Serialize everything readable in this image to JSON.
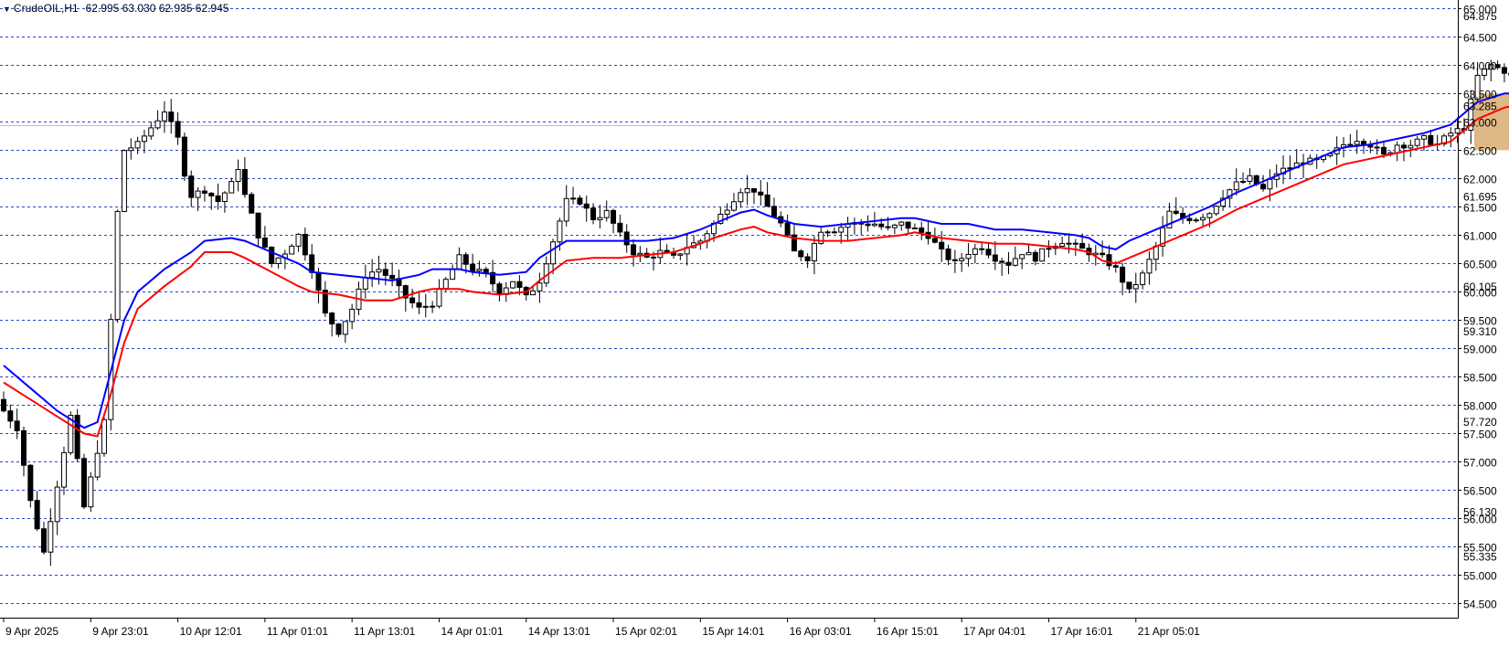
{
  "window": {
    "symbol_label": "CrudeOIL,H1",
    "ohlc_label": "62.995 63.030 62.935 62.945"
  },
  "colors": {
    "background": "#ffffff",
    "grid": "#2a45c9",
    "axis": "#000000",
    "price_highlight": "#2a45c9",
    "ma_fast": "#0000ff",
    "ma_slow": "#ff0000",
    "zone": "#deb887",
    "bull_candle": "#ffffff",
    "bear_candle": "#000000"
  },
  "chart_data": {
    "type": "candlestick",
    "ylim": [
      54.25,
      65.15
    ],
    "grid": true,
    "price_levels": [
      "65.000",
      "64.500",
      "64.000",
      "63.500",
      "63.000",
      "62.500",
      "62.000",
      "61.500",
      "61.000",
      "60.500",
      "60.000",
      "59.500",
      "59.000",
      "58.500",
      "58.000",
      "57.500",
      "57.000",
      "56.500",
      "56.000",
      "55.500",
      "55.000",
      "54.500"
    ],
    "minor_labels": [
      "64.875",
      "63.285",
      "61.695",
      "60.105",
      "59.310",
      "57.720",
      "56.130",
      "55.335"
    ],
    "x_labels": [
      "9 Apr 2025",
      "9 Apr 23:01",
      "10 Apr 12:01",
      "11 Apr 01:01",
      "11 Apr 13:01",
      "14 Apr 01:01",
      "14 Apr 13:01",
      "15 Apr 02:01",
      "15 Apr 14:01",
      "16 Apr 03:01",
      "16 Apr 15:01",
      "17 Apr 04:01",
      "17 Apr 16:01",
      "21 Apr 05:01"
    ],
    "bars_per_label": 13,
    "close_path": [
      [
        0,
        57.9
      ],
      [
        2,
        57.6
      ],
      [
        4,
        56.3
      ],
      [
        6,
        55.4
      ],
      [
        8,
        56.6
      ],
      [
        10,
        57.8
      ],
      [
        12,
        56.2
      ],
      [
        14,
        57.2
      ],
      [
        15,
        57.7
      ],
      [
        16,
        59.5
      ],
      [
        17,
        61.4
      ],
      [
        18,
        62.5
      ],
      [
        20,
        62.6
      ],
      [
        22,
        62.9
      ],
      [
        24,
        63.2
      ],
      [
        26,
        62.7
      ],
      [
        27,
        62.1
      ],
      [
        28,
        61.7
      ],
      [
        30,
        61.8
      ],
      [
        32,
        61.6
      ],
      [
        34,
        61.9
      ],
      [
        35,
        62.2
      ],
      [
        36,
        61.7
      ],
      [
        38,
        61.0
      ],
      [
        40,
        60.5
      ],
      [
        42,
        60.7
      ],
      [
        44,
        61.0
      ],
      [
        46,
        60.4
      ],
      [
        48,
        59.6
      ],
      [
        50,
        59.3
      ],
      [
        52,
        59.7
      ],
      [
        54,
        60.3
      ],
      [
        56,
        60.4
      ],
      [
        58,
        60.2
      ],
      [
        60,
        59.9
      ],
      [
        62,
        59.7
      ],
      [
        64,
        59.8
      ],
      [
        66,
        60.2
      ],
      [
        68,
        60.6
      ],
      [
        70,
        60.4
      ],
      [
        72,
        60.3
      ],
      [
        74,
        60.0
      ],
      [
        76,
        60.2
      ],
      [
        78,
        59.9
      ],
      [
        80,
        60.2
      ],
      [
        82,
        60.9
      ],
      [
        84,
        61.6
      ],
      [
        86,
        61.6
      ],
      [
        88,
        61.3
      ],
      [
        90,
        61.4
      ],
      [
        92,
        61.0
      ],
      [
        94,
        60.7
      ],
      [
        96,
        60.6
      ],
      [
        98,
        60.7
      ],
      [
        100,
        60.6
      ],
      [
        102,
        60.8
      ],
      [
        104,
        60.9
      ],
      [
        106,
        61.2
      ],
      [
        108,
        61.5
      ],
      [
        110,
        61.8
      ],
      [
        112,
        61.8
      ],
      [
        114,
        61.5
      ],
      [
        116,
        61.2
      ],
      [
        118,
        60.7
      ],
      [
        120,
        60.6
      ],
      [
        122,
        61.1
      ],
      [
        124,
        61.1
      ],
      [
        126,
        61.2
      ],
      [
        128,
        61.2
      ],
      [
        130,
        61.2
      ],
      [
        132,
        61.1
      ],
      [
        134,
        61.2
      ],
      [
        136,
        61.1
      ],
      [
        138,
        61.0
      ],
      [
        140,
        60.7
      ],
      [
        142,
        60.5
      ],
      [
        144,
        60.7
      ],
      [
        146,
        60.8
      ],
      [
        148,
        60.6
      ],
      [
        150,
        60.5
      ],
      [
        152,
        60.7
      ],
      [
        154,
        60.6
      ],
      [
        156,
        60.8
      ],
      [
        158,
        60.9
      ],
      [
        160,
        60.8
      ],
      [
        162,
        60.7
      ],
      [
        164,
        60.6
      ],
      [
        166,
        60.4
      ],
      [
        168,
        60.0
      ],
      [
        170,
        60.3
      ],
      [
        172,
        60.8
      ],
      [
        174,
        61.4
      ],
      [
        176,
        61.3
      ],
      [
        178,
        61.3
      ],
      [
        180,
        61.4
      ],
      [
        182,
        61.7
      ],
      [
        184,
        61.9
      ],
      [
        186,
        62.0
      ],
      [
        188,
        61.8
      ],
      [
        190,
        62.1
      ],
      [
        192,
        62.2
      ],
      [
        194,
        62.3
      ],
      [
        196,
        62.3
      ],
      [
        198,
        62.4
      ],
      [
        200,
        62.6
      ],
      [
        202,
        62.7
      ],
      [
        204,
        62.6
      ],
      [
        206,
        62.4
      ],
      [
        208,
        62.6
      ],
      [
        210,
        62.6
      ],
      [
        212,
        62.7
      ],
      [
        214,
        62.6
      ],
      [
        216,
        62.8
      ],
      [
        218,
        62.9
      ],
      [
        220,
        63.8
      ],
      [
        222,
        64.0
      ],
      [
        224,
        63.9
      ],
      [
        226,
        63.7
      ],
      [
        228,
        63.2
      ],
      [
        230,
        63.1
      ],
      [
        232,
        63.0
      ],
      [
        234,
        62.9
      ],
      [
        236,
        63.0
      ],
      [
        237,
        62.95
      ]
    ],
    "series": [
      {
        "name": "",
        "color": "#0000ff",
        "points": [
          [
            0,
            58.7
          ],
          [
            4,
            58.3
          ],
          [
            8,
            57.9
          ],
          [
            12,
            57.6
          ],
          [
            14,
            57.7
          ],
          [
            16,
            58.6
          ],
          [
            18,
            59.5
          ],
          [
            20,
            60.0
          ],
          [
            24,
            60.4
          ],
          [
            28,
            60.7
          ],
          [
            30,
            60.9
          ],
          [
            34,
            60.95
          ],
          [
            36,
            60.9
          ],
          [
            40,
            60.7
          ],
          [
            44,
            60.5
          ],
          [
            46,
            60.35
          ],
          [
            50,
            60.3
          ],
          [
            54,
            60.25
          ],
          [
            58,
            60.2
          ],
          [
            62,
            60.3
          ],
          [
            64,
            60.4
          ],
          [
            68,
            60.4
          ],
          [
            70,
            60.35
          ],
          [
            74,
            60.3
          ],
          [
            78,
            60.35
          ],
          [
            80,
            60.6
          ],
          [
            84,
            60.9
          ],
          [
            88,
            60.9
          ],
          [
            92,
            60.9
          ],
          [
            96,
            60.9
          ],
          [
            100,
            60.95
          ],
          [
            104,
            61.1
          ],
          [
            106,
            61.2
          ],
          [
            110,
            61.4
          ],
          [
            112,
            61.45
          ],
          [
            114,
            61.35
          ],
          [
            118,
            61.2
          ],
          [
            122,
            61.15
          ],
          [
            126,
            61.2
          ],
          [
            130,
            61.25
          ],
          [
            134,
            61.3
          ],
          [
            136,
            61.3
          ],
          [
            140,
            61.2
          ],
          [
            144,
            61.2
          ],
          [
            148,
            61.1
          ],
          [
            152,
            61.1
          ],
          [
            156,
            61.05
          ],
          [
            160,
            61.0
          ],
          [
            162,
            60.95
          ],
          [
            164,
            60.8
          ],
          [
            166,
            60.75
          ],
          [
            168,
            60.9
          ],
          [
            172,
            61.1
          ],
          [
            176,
            61.3
          ],
          [
            180,
            61.5
          ],
          [
            184,
            61.75
          ],
          [
            188,
            61.95
          ],
          [
            192,
            62.15
          ],
          [
            196,
            62.35
          ],
          [
            200,
            62.55
          ],
          [
            204,
            62.6
          ],
          [
            208,
            62.7
          ],
          [
            212,
            62.8
          ],
          [
            216,
            62.95
          ],
          [
            218,
            63.15
          ],
          [
            220,
            63.35
          ],
          [
            224,
            63.5
          ],
          [
            228,
            63.5
          ],
          [
            232,
            63.45
          ],
          [
            235,
            63.45
          ]
        ]
      },
      {
        "name": "",
        "color": "#ff0000",
        "points": [
          [
            0,
            58.4
          ],
          [
            4,
            58.1
          ],
          [
            8,
            57.8
          ],
          [
            12,
            57.5
          ],
          [
            14,
            57.45
          ],
          [
            16,
            58.2
          ],
          [
            18,
            59.1
          ],
          [
            20,
            59.7
          ],
          [
            24,
            60.1
          ],
          [
            28,
            60.45
          ],
          [
            30,
            60.7
          ],
          [
            34,
            60.7
          ],
          [
            36,
            60.6
          ],
          [
            40,
            60.35
          ],
          [
            44,
            60.1
          ],
          [
            46,
            60.0
          ],
          [
            50,
            59.95
          ],
          [
            54,
            59.85
          ],
          [
            58,
            59.85
          ],
          [
            62,
            60.0
          ],
          [
            64,
            60.05
          ],
          [
            68,
            60.05
          ],
          [
            70,
            60.0
          ],
          [
            74,
            59.95
          ],
          [
            78,
            60.0
          ],
          [
            80,
            60.2
          ],
          [
            84,
            60.55
          ],
          [
            88,
            60.6
          ],
          [
            92,
            60.6
          ],
          [
            96,
            60.65
          ],
          [
            100,
            60.7
          ],
          [
            104,
            60.85
          ],
          [
            106,
            60.95
          ],
          [
            110,
            61.1
          ],
          [
            112,
            61.15
          ],
          [
            114,
            61.05
          ],
          [
            118,
            60.95
          ],
          [
            122,
            60.9
          ],
          [
            126,
            60.9
          ],
          [
            130,
            60.95
          ],
          [
            134,
            61.0
          ],
          [
            136,
            61.05
          ],
          [
            140,
            60.95
          ],
          [
            144,
            60.9
          ],
          [
            148,
            60.85
          ],
          [
            152,
            60.85
          ],
          [
            156,
            60.8
          ],
          [
            160,
            60.75
          ],
          [
            162,
            60.7
          ],
          [
            164,
            60.55
          ],
          [
            166,
            60.5
          ],
          [
            168,
            60.6
          ],
          [
            172,
            60.8
          ],
          [
            176,
            61.0
          ],
          [
            180,
            61.2
          ],
          [
            184,
            61.45
          ],
          [
            188,
            61.65
          ],
          [
            192,
            61.85
          ],
          [
            196,
            62.05
          ],
          [
            200,
            62.25
          ],
          [
            204,
            62.35
          ],
          [
            208,
            62.45
          ],
          [
            212,
            62.55
          ],
          [
            216,
            62.65
          ],
          [
            218,
            62.85
          ],
          [
            220,
            63.05
          ],
          [
            224,
            63.25
          ],
          [
            228,
            63.35
          ],
          [
            232,
            63.3
          ],
          [
            235,
            63.3
          ]
        ]
      }
    ],
    "zone": {
      "x_from": 219.5,
      "x_to": 254,
      "y_from": 62.5,
      "y_to": 63.5
    },
    "current_price": 62.945
  }
}
